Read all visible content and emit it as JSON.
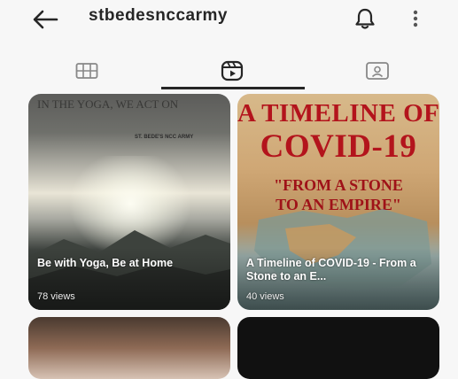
{
  "header": {
    "username": "stbedesnccarmy",
    "back_icon": "arrow-left-icon",
    "notifications_icon": "bell-icon",
    "more_icon": "more-vertical-icon"
  },
  "tabs": [
    {
      "icon": "grid-icon",
      "active": false
    },
    {
      "icon": "reels-icon",
      "active": true
    },
    {
      "icon": "tagged-icon",
      "active": false
    }
  ],
  "posts": [
    {
      "caption": "Be with Yoga, Be at Home",
      "views": "78 views",
      "overlay_top": "IN THE YOGA, WE ACT ON",
      "overlay_sub": "ST. BEDE'S NCC ARMY"
    },
    {
      "caption": "A Timeline of COVID-19 - From a Stone to an E...",
      "views": "40 views",
      "poster_line1": "A TIMELINE OF",
      "poster_line2": "COVID-19",
      "poster_line3": "\"FROM A STONE",
      "poster_line4": "TO AN EMPIRE\""
    }
  ],
  "colors": {
    "poster_red": "#b3141c",
    "text": "#262626",
    "background": "#f7f7f7"
  }
}
